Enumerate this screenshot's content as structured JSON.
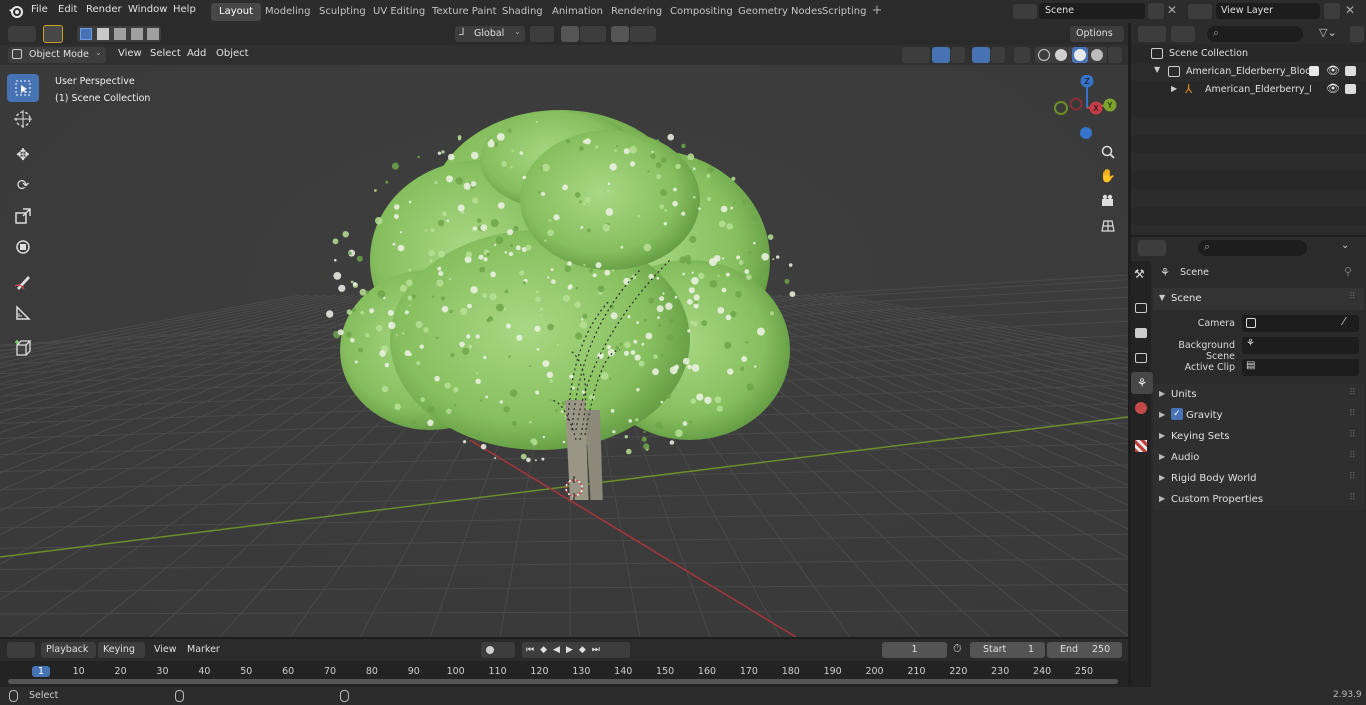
{
  "menu": [
    "File",
    "Edit",
    "Render",
    "Window",
    "Help"
  ],
  "workspaces": [
    "Layout",
    "Modeling",
    "Sculpting",
    "UV Editing",
    "Texture Paint",
    "Shading",
    "Animation",
    "Rendering",
    "Compositing",
    "Geometry Nodes",
    "Scripting"
  ],
  "scene_name": "Scene",
  "view_layer": "View Layer",
  "viewport_header": {
    "mode": "Object Mode",
    "view": "View",
    "select": "Select",
    "add": "Add",
    "object": "Object",
    "orientation": "Global",
    "options": "Options"
  },
  "viewport": {
    "perspective": "User Perspective",
    "collection": "(1) Scene Collection",
    "gizmo_axes": [
      "Z",
      "Y",
      "X"
    ]
  },
  "outliner": {
    "root": "Scene Collection",
    "items": [
      {
        "label": "American_Elderberry_Bloomin"
      },
      {
        "label": "American_Elderberry_Blc"
      }
    ]
  },
  "properties": {
    "context": "Scene",
    "panel_title": "Scene",
    "camera_label": "Camera",
    "background_scene_label": "Background Scene",
    "active_clip_label": "Active Clip",
    "panels": [
      "Units",
      "Gravity",
      "Keying Sets",
      "Audio",
      "Rigid Body World",
      "Custom Properties"
    ],
    "gravity_checked": true
  },
  "timeline": {
    "playback": "Playback",
    "keying": "Keying",
    "view": "View",
    "marker": "Marker",
    "current_frame": "1",
    "start_label": "Start",
    "start": "1",
    "end_label": "End",
    "end": "250",
    "ticks": [
      "1",
      "10",
      "20",
      "30",
      "40",
      "50",
      "60",
      "70",
      "80",
      "90",
      "100",
      "110",
      "120",
      "130",
      "140",
      "150",
      "160",
      "170",
      "180",
      "190",
      "200",
      "210",
      "220",
      "230",
      "240",
      "250"
    ]
  },
  "status": {
    "select": "Select",
    "version": "2.93.9"
  },
  "colors": {
    "accent": "#4772b3",
    "axis_x": "#c53b46",
    "axis_y": "#7da12b",
    "axis_z": "#3574c8",
    "foliage": "#8fc36a"
  }
}
